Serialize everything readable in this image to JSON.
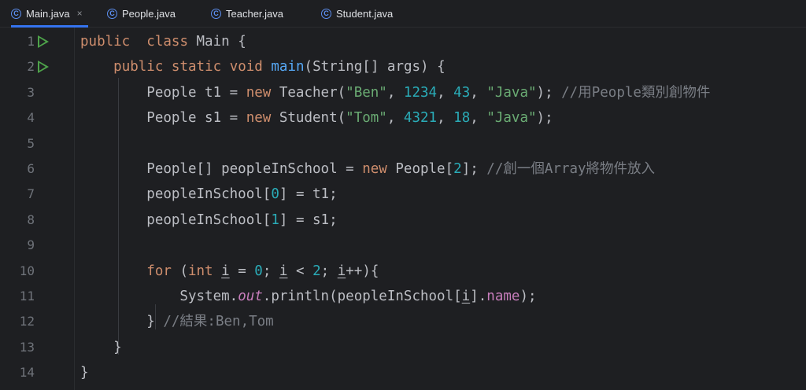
{
  "tabs": [
    {
      "label": "Main.java",
      "icon": "class-icon",
      "active": true,
      "close": "×"
    },
    {
      "label": "People.java",
      "icon": "class-icon"
    },
    {
      "label": "Teacher.java",
      "icon": "class-icon"
    },
    {
      "label": "Student.java",
      "icon": "class-icon"
    }
  ],
  "class_icon_glyph": "C",
  "colors": {
    "background": "#1e1f22",
    "keyword": "#cf8e6d",
    "method": "#56a8f5",
    "string": "#6aab73",
    "number": "#2aacb8",
    "comment": "#7a7e85",
    "field": "#c77dbb",
    "run_icon": "#4ea34a"
  },
  "lines": [
    {
      "n": "1",
      "run": true,
      "tokens": [
        [
          "kw",
          "public"
        ],
        [
          "",
          "  "
        ],
        [
          "kw",
          "class"
        ],
        [
          "",
          " Main {"
        ]
      ]
    },
    {
      "n": "2",
      "run": true,
      "tokens": [
        [
          "",
          "    "
        ],
        [
          "kw",
          "public"
        ],
        [
          "",
          " "
        ],
        [
          "kw",
          "static"
        ],
        [
          "",
          " "
        ],
        [
          "kw",
          "void"
        ],
        [
          "",
          " "
        ],
        [
          "fn",
          "main"
        ],
        [
          "",
          "(String[] args) {"
        ]
      ]
    },
    {
      "n": "3",
      "tokens": [
        [
          "",
          "        People t1 = "
        ],
        [
          "kw",
          "new"
        ],
        [
          "",
          " Teacher("
        ],
        [
          "str",
          "\"Ben\""
        ],
        [
          "",
          ", "
        ],
        [
          "num",
          "1234"
        ],
        [
          "",
          ", "
        ],
        [
          "num",
          "43"
        ],
        [
          "",
          ", "
        ],
        [
          "str",
          "\"Java\""
        ],
        [
          "",
          "); "
        ],
        [
          "cm",
          "//用People類別創物件"
        ]
      ]
    },
    {
      "n": "4",
      "tokens": [
        [
          "",
          "        People s1 = "
        ],
        [
          "kw",
          "new"
        ],
        [
          "",
          " Student("
        ],
        [
          "str",
          "\"Tom\""
        ],
        [
          "",
          ", "
        ],
        [
          "num",
          "4321"
        ],
        [
          "",
          ", "
        ],
        [
          "num",
          "18"
        ],
        [
          "",
          ", "
        ],
        [
          "str",
          "\"Java\""
        ],
        [
          "",
          ");"
        ]
      ]
    },
    {
      "n": "5",
      "tokens": []
    },
    {
      "n": "6",
      "tokens": [
        [
          "",
          "        People[] peopleInSchool = "
        ],
        [
          "kw",
          "new"
        ],
        [
          "",
          " People["
        ],
        [
          "num",
          "2"
        ],
        [
          "",
          "]; "
        ],
        [
          "cm",
          "//創一個Array將物件放入"
        ]
      ]
    },
    {
      "n": "7",
      "tokens": [
        [
          "",
          "        peopleInSchool["
        ],
        [
          "num",
          "0"
        ],
        [
          "",
          "] = t1;"
        ]
      ]
    },
    {
      "n": "8",
      "tokens": [
        [
          "",
          "        peopleInSchool["
        ],
        [
          "num",
          "1"
        ],
        [
          "",
          "] = s1;"
        ]
      ]
    },
    {
      "n": "9",
      "tokens": []
    },
    {
      "n": "10",
      "tokens": [
        [
          "",
          "        "
        ],
        [
          "kw",
          "for"
        ],
        [
          "",
          " ("
        ],
        [
          "kw",
          "int"
        ],
        [
          "",
          " "
        ],
        [
          "ul",
          "i"
        ],
        [
          "",
          " = "
        ],
        [
          "num",
          "0"
        ],
        [
          "",
          "; "
        ],
        [
          "ul",
          "i"
        ],
        [
          "",
          " < "
        ],
        [
          "num",
          "2"
        ],
        [
          "",
          "; "
        ],
        [
          "ul",
          "i"
        ],
        [
          "",
          "++){"
        ]
      ]
    },
    {
      "n": "11",
      "tokens": [
        [
          "",
          "            System."
        ],
        [
          "st",
          "out"
        ],
        [
          "",
          ".println(peopleInSchool["
        ],
        [
          "ul",
          "i"
        ],
        [
          "",
          "]."
        ],
        [
          "fld",
          "name"
        ],
        [
          "",
          ");"
        ]
      ]
    },
    {
      "n": "12",
      "tokens": [
        [
          "",
          "        } "
        ],
        [
          "cm",
          "//結果:Ben,Tom"
        ]
      ]
    },
    {
      "n": "13",
      "tokens": [
        [
          "",
          "    }"
        ]
      ]
    },
    {
      "n": "14",
      "tokens": [
        [
          "",
          "}"
        ]
      ]
    }
  ]
}
